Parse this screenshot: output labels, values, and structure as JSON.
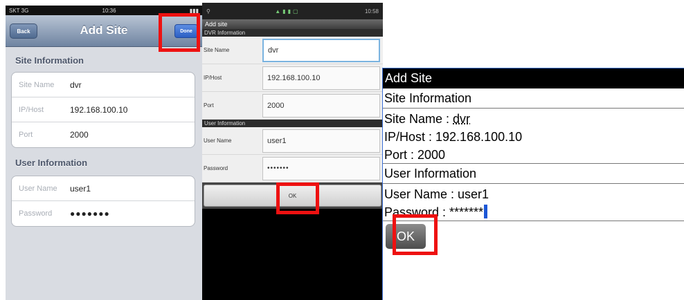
{
  "ios": {
    "status_carrier": "SKT 3G",
    "status_time": "10:36",
    "title": "Add Site",
    "back_label": "Back",
    "done_label": "Done",
    "site_section": "Site Information",
    "site_rows": [
      {
        "label": "Site Name",
        "value": "dvr"
      },
      {
        "label": "IP/Host",
        "value": "192.168.100.10"
      },
      {
        "label": "Port",
        "value": "2000"
      }
    ],
    "user_section": "User Information",
    "user_rows": [
      {
        "label": "User Name",
        "value": "user1"
      },
      {
        "label": "Password",
        "value": "●●●●●●●"
      }
    ]
  },
  "android": {
    "status_time": "10:58",
    "title": "Add site",
    "dvr_section": "DVR Information",
    "rows": [
      {
        "label": "Site Name",
        "value": "dvr"
      },
      {
        "label": "IP/Host",
        "value": "192.168.100.10"
      },
      {
        "label": "Port",
        "value": "2000"
      }
    ],
    "user_section": "User Information",
    "user_rows": [
      {
        "label": "User Name",
        "value": "user1"
      },
      {
        "label": "Password",
        "value": "•••••••"
      }
    ],
    "ok_label": "OK"
  },
  "blackberry": {
    "title": "Add Site",
    "site_section": "Site Information",
    "site_name": "Site Name : ",
    "site_name_value": "dvr",
    "ip_host": "IP/Host : 192.168.100.10",
    "port": "Port : 2000",
    "user_section": "User Information",
    "user_name": "User Name : user1",
    "password": "Password : *******",
    "ok_label": "OK"
  },
  "colors": {
    "highlight": "#ee1111",
    "ios_nav": "#6f84a1",
    "bb_cursor": "#1c57d6"
  }
}
